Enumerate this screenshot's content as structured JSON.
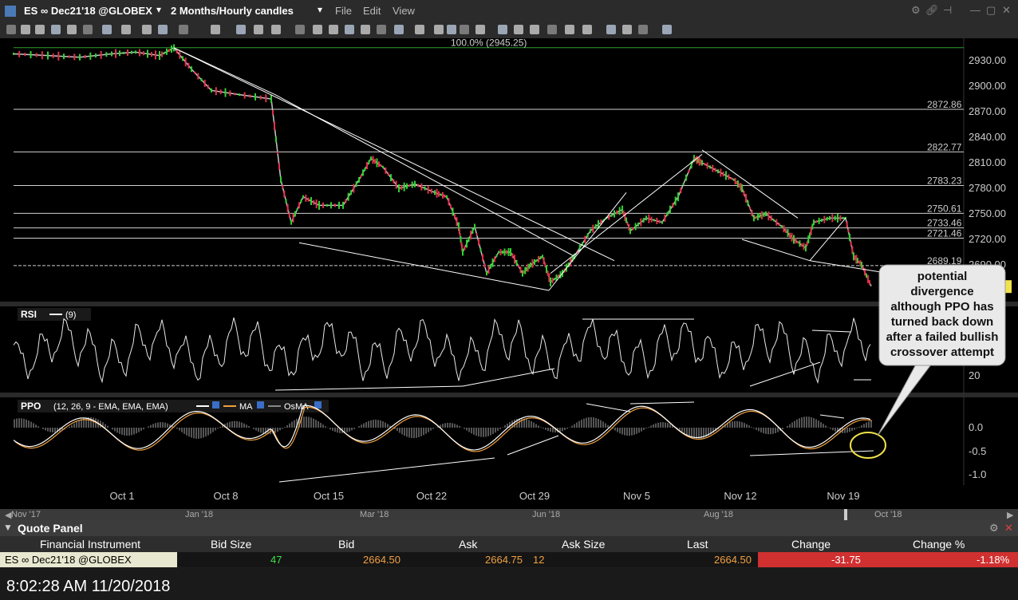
{
  "titlebar": {
    "symbol": "ES ∞ Dec21'18 @GLOBEX",
    "timeframe": "2 Months/Hourly candles",
    "menu": [
      "File",
      "Edit",
      "View"
    ]
  },
  "chart": {
    "price_axis": [
      "2930.00",
      "2900.00",
      "2870.00",
      "2840.00",
      "2810.00",
      "2780.00",
      "2750.00",
      "2720.00",
      "2690.00",
      "2660.00"
    ],
    "levels": [
      {
        "label": "100.0% (2945.25)",
        "price": 2945.25
      },
      {
        "label": "2872.86",
        "price": 2872.86
      },
      {
        "label": "2822.77",
        "price": 2822.77
      },
      {
        "label": "2783.23",
        "price": 2783.23
      },
      {
        "label": "2750.61",
        "price": 2750.61
      },
      {
        "label": "2733.46",
        "price": 2733.46
      },
      {
        "label": "2721.46",
        "price": 2721.46
      },
      {
        "label": "2689.19",
        "price": 2689.19
      }
    ],
    "last_price": "2664.50",
    "x_labels": [
      "Oct 1",
      "Oct 8",
      "Oct 15",
      "Oct 22",
      "Oct 29",
      "Nov 5",
      "Nov 12",
      "Nov 19"
    ],
    "rsi": {
      "label": "RSI",
      "param": "(9)",
      "axis": "20"
    },
    "ppo": {
      "label": "PPO",
      "params": "(12, 26, 9 - EMA, EMA, EMA)",
      "ma": "MA",
      "osma": "OsMA",
      "axis": [
        "0.0",
        "-0.5",
        "-1.0"
      ]
    },
    "callout": [
      "potential",
      "divergence",
      "although PPO has",
      "turned back down",
      "after a failed bullish",
      "crossover attempt"
    ]
  },
  "navigator": [
    "Nov '17",
    "Jan '18",
    "Mar '18",
    "Jun '18",
    "Aug '18",
    "Oct '18"
  ],
  "quote_panel": {
    "title": "Quote Panel",
    "headers": [
      "Financial Instrument",
      "Bid Size",
      "Bid",
      "Ask",
      "Ask Size",
      "Last",
      "Change",
      "Change %"
    ],
    "row": {
      "instrument": "ES ∞ Dec21'18 @GLOBEX",
      "bid_size": "47",
      "bid": "2664.50",
      "ask": "2664.75",
      "ask_size": "12",
      "last": "2664.50",
      "change": "-31.75",
      "change_pct": "-1.18%"
    }
  },
  "status": {
    "time": "8:02:28 AM 11/20/2018"
  }
}
